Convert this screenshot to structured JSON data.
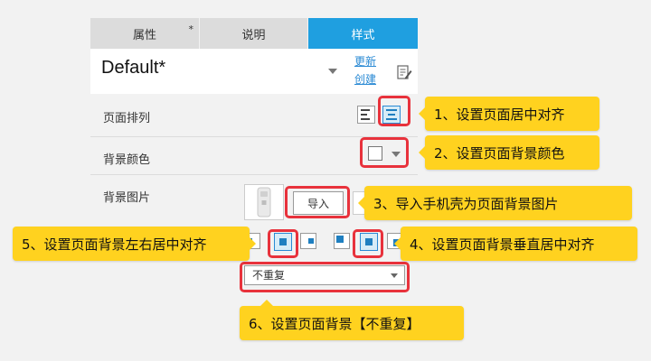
{
  "tabs": [
    {
      "label": "属性",
      "marker": "*"
    },
    {
      "label": "说明"
    },
    {
      "label": "样式",
      "active": true
    }
  ],
  "header": {
    "title": "Default*",
    "update_link": "更新",
    "create_link": "创建",
    "edit_icon": "edit-icon"
  },
  "rows": {
    "page_align_label": "页面排列",
    "bg_color_label": "背景颜色",
    "bg_image_label": "背景图片"
  },
  "image": {
    "import_label": "导入",
    "repeat_selected": "不重复"
  },
  "callouts": {
    "c1": "1、设置页面居中对齐",
    "c2": "2、设置页面背景颜色",
    "c3": "3、导入手机壳为页面背景图片",
    "c4": "4、设置页面背景垂直居中对齐",
    "c5": "5、设置页面背景左右居中对齐",
    "c6": "6、设置页面背景【不重复】"
  },
  "colors": {
    "active_tab": "#1f9fe0",
    "highlight": "#e8323c",
    "callout": "#ffd21f",
    "link": "#2a8ad4"
  }
}
